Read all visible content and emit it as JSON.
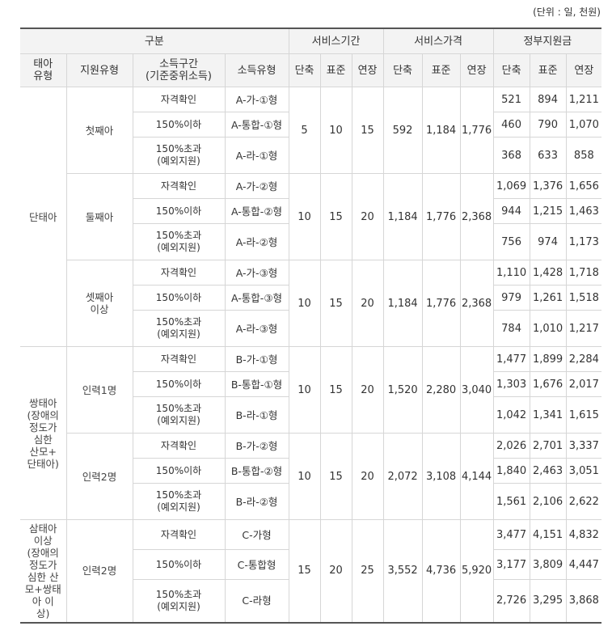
{
  "unit_note": "(단위 : 일, 천원)",
  "header": {
    "group": "구분",
    "service_period": "서비스기간",
    "service_price": "서비스가격",
    "gov_support": "정부지원금",
    "col_fetus": "태아\n유형",
    "col_support_type": "지원유형",
    "col_income_range": "소득구간\n(기준중위소득)",
    "col_income_type": "소득유형",
    "sub": [
      "단축",
      "표준",
      "연장",
      "단축",
      "표준",
      "연장",
      "단축",
      "표준",
      "연장"
    ]
  },
  "sections": [
    {
      "fetus": "단태아",
      "groups": [
        {
          "support": "첫째아",
          "period": [
            "5",
            "10",
            "15"
          ],
          "price": [
            "592",
            "1,184",
            "1,776"
          ],
          "rows": [
            {
              "income_band": "자격확인",
              "income_type": "A-가-①형",
              "support": [
                "521",
                "894",
                "1,211"
              ]
            },
            {
              "income_band": "150%이하",
              "income_type": "A-통합-①형",
              "support": [
                "460",
                "790",
                "1,070"
              ]
            },
            {
              "income_band": "150%초과\n(예외지원)",
              "income_type": "A-라-①형",
              "support": [
                "368",
                "633",
                "858"
              ]
            }
          ]
        },
        {
          "support": "둘째아",
          "period": [
            "10",
            "15",
            "20"
          ],
          "price": [
            "1,184",
            "1,776",
            "2,368"
          ],
          "rows": [
            {
              "income_band": "자격확인",
              "income_type": "A-가-②형",
              "support": [
                "1,069",
                "1,376",
                "1,656"
              ]
            },
            {
              "income_band": "150%이하",
              "income_type": "A-통합-②형",
              "support": [
                "944",
                "1,215",
                "1,463"
              ]
            },
            {
              "income_band": "150%초과\n(예외지원)",
              "income_type": "A-라-②형",
              "support": [
                "756",
                "974",
                "1,173"
              ]
            }
          ]
        },
        {
          "support": "셋째아\n이상",
          "period": [
            "10",
            "15",
            "20"
          ],
          "price": [
            "1,184",
            "1,776",
            "2,368"
          ],
          "rows": [
            {
              "income_band": "자격확인",
              "income_type": "A-가-③형",
              "support": [
                "1,110",
                "1,428",
                "1,718"
              ]
            },
            {
              "income_band": "150%이하",
              "income_type": "A-통합-③형",
              "support": [
                "979",
                "1,261",
                "1,518"
              ]
            },
            {
              "income_band": "150%초과\n(예외지원)",
              "income_type": "A-라-③형",
              "support": [
                "784",
                "1,010",
                "1,217"
              ]
            }
          ]
        }
      ]
    },
    {
      "fetus": "쌍태아\n(장애의\n정도가\n심한\n산모+\n단태아)",
      "groups": [
        {
          "support": "인력1명",
          "period": [
            "10",
            "15",
            "20"
          ],
          "price": [
            "1,520",
            "2,280",
            "3,040"
          ],
          "rows": [
            {
              "income_band": "자격확인",
              "income_type": "B-가-①형",
              "support": [
                "1,477",
                "1,899",
                "2,284"
              ]
            },
            {
              "income_band": "150%이하",
              "income_type": "B-통합-①형",
              "support": [
                "1,303",
                "1,676",
                "2,017"
              ]
            },
            {
              "income_band": "150%초과\n(예외지원)",
              "income_type": "B-라-①형",
              "support": [
                "1,042",
                "1,341",
                "1,615"
              ]
            }
          ]
        },
        {
          "support": "인력2명",
          "period": [
            "10",
            "15",
            "20"
          ],
          "price": [
            "2,072",
            "3,108",
            "4,144"
          ],
          "rows": [
            {
              "income_band": "자격확인",
              "income_type": "B-가-②형",
              "support": [
                "2,026",
                "2,701",
                "3,337"
              ]
            },
            {
              "income_band": "150%이하",
              "income_type": "B-통합-②형",
              "support": [
                "1,840",
                "2,463",
                "3,051"
              ]
            },
            {
              "income_band": "150%초과\n(예외지원)",
              "income_type": "B-라-②형",
              "support": [
                "1,561",
                "2,106",
                "2,622"
              ]
            }
          ]
        }
      ]
    },
    {
      "fetus": "삼태아\n이상\n(장애의\n정도가\n심한 산\n모+쌍태\n아 이\n상)",
      "groups": [
        {
          "support": "인력2명",
          "period": [
            "15",
            "20",
            "25"
          ],
          "price": [
            "3,552",
            "4,736",
            "5,920"
          ],
          "rows": [
            {
              "income_band": "자격확인",
              "income_type": "C-가형",
              "support": [
                "3,477",
                "4,151",
                "4,832"
              ]
            },
            {
              "income_band": "150%이하",
              "income_type": "C-통합형",
              "support": [
                "3,177",
                "3,809",
                "4,447"
              ]
            },
            {
              "income_band": "150%초과\n(예외지원)",
              "income_type": "C-라형",
              "support": [
                "2,726",
                "3,295",
                "3,868"
              ]
            }
          ]
        }
      ]
    }
  ]
}
